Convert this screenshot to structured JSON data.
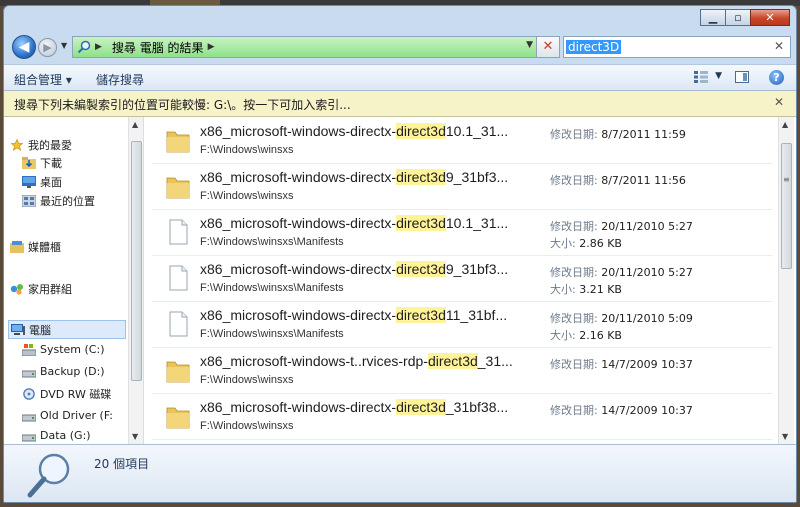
{
  "address": {
    "crumb": "搜尋 電腦 的結果",
    "search_value": "direct3D"
  },
  "toolbar": {
    "organize": "組合管理 ▾",
    "save_search": "儲存搜尋",
    "help": "?"
  },
  "infobar": {
    "message": "搜尋下列未編製索引的位置可能較慢: G:\\。按一下可加入索引..."
  },
  "nav": {
    "favorites": "我的最愛",
    "downloads": "下載",
    "desktop": "桌面",
    "recent": "最近的位置",
    "libraries": "媒體櫃",
    "homegroup": "家用群組",
    "computer": "電腦",
    "drives": [
      {
        "label": "System (C:)"
      },
      {
        "label": "Backup (D:)"
      },
      {
        "label": "DVD RW 磁碟"
      },
      {
        "label": "Old Driver (F:"
      },
      {
        "label": "Data (G:)"
      }
    ]
  },
  "results": [
    {
      "pre": "x86_microsoft-windows-directx-",
      "hl": "direct3d",
      "post": "10.1_31...",
      "path": "F:\\Windows\\winsxs",
      "date_label": "修改日期:",
      "date": "8/7/2011 11:59",
      "size_label": "",
      "size": "",
      "type": "folder"
    },
    {
      "pre": "x86_microsoft-windows-directx-",
      "hl": "direct3d",
      "post": "9_31bf3...",
      "path": "F:\\Windows\\winsxs",
      "date_label": "修改日期:",
      "date": "8/7/2011 11:56",
      "size_label": "",
      "size": "",
      "type": "folder"
    },
    {
      "pre": "x86_microsoft-windows-directx-",
      "hl": "direct3d",
      "post": "10.1_31...",
      "path": "F:\\Windows\\winsxs\\Manifests",
      "date_label": "修改日期:",
      "date": "20/11/2010 5:27",
      "size_label": "大小:",
      "size": "2.86 KB",
      "type": "file"
    },
    {
      "pre": "x86_microsoft-windows-directx-",
      "hl": "direct3d",
      "post": "9_31bf3...",
      "path": "F:\\Windows\\winsxs\\Manifests",
      "date_label": "修改日期:",
      "date": "20/11/2010 5:27",
      "size_label": "大小:",
      "size": "3.21 KB",
      "type": "file"
    },
    {
      "pre": "x86_microsoft-windows-directx-",
      "hl": "direct3d",
      "post": "11_31bf...",
      "path": "F:\\Windows\\winsxs\\Manifests",
      "date_label": "修改日期:",
      "date": "20/11/2010 5:09",
      "size_label": "大小:",
      "size": "2.16 KB",
      "type": "file"
    },
    {
      "pre": "x86_microsoft-windows-t..rvices-rdp-",
      "hl": "direct3d",
      "post": "_31...",
      "path": "F:\\Windows\\winsxs",
      "date_label": "修改日期:",
      "date": "14/7/2009 10:37",
      "size_label": "",
      "size": "",
      "type": "folder"
    },
    {
      "pre": "x86_microsoft-windows-directx-",
      "hl": "direct3d",
      "post": "_31bf38...",
      "path": "F:\\Windows\\winsxs",
      "date_label": "修改日期:",
      "date": "14/7/2009 10:37",
      "size_label": "",
      "size": "",
      "type": "folder"
    }
  ],
  "status": {
    "count": "20 個項目"
  }
}
